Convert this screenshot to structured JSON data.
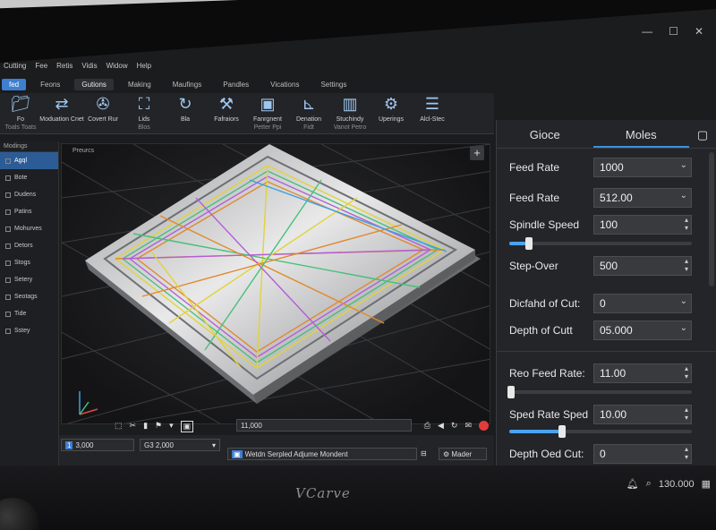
{
  "menu": [
    "Cutting",
    "Fee",
    "Retis",
    "Vidis",
    "Widow",
    "Help"
  ],
  "tabs": [
    {
      "label": "fed",
      "state": "active"
    },
    {
      "label": "Feons",
      "state": ""
    },
    {
      "label": "Gutions",
      "state": "sel"
    },
    {
      "label": "Making",
      "state": ""
    },
    {
      "label": "Maufings",
      "state": ""
    },
    {
      "label": "Pandles",
      "state": ""
    },
    {
      "label": "Vications",
      "state": ""
    },
    {
      "label": "Settings",
      "state": ""
    }
  ],
  "ribbon": [
    {
      "label": "Fo",
      "sub": "Toals Toats",
      "icon": "folder-icon"
    },
    {
      "label": "Moduation Cnet",
      "sub": "",
      "icon": "arrows-icon"
    },
    {
      "label": "Covert Rur",
      "sub": "",
      "icon": "fan-icon"
    },
    {
      "label": "Lids",
      "sub": "Blos",
      "icon": "frame-icon"
    },
    {
      "label": "Bla",
      "sub": "",
      "icon": "rotate-icon"
    },
    {
      "label": "Fafraiors",
      "sub": "",
      "icon": "tools-icon"
    },
    {
      "label": "Fanrgnent",
      "sub": "Petter Ppi",
      "icon": "box-icon"
    },
    {
      "label": "Denation",
      "sub": "Fidt",
      "icon": "axis-icon"
    },
    {
      "label": "Stuchindy",
      "sub": "Vanot Petro",
      "icon": "cylinder-icon"
    },
    {
      "label": "Uperings",
      "sub": "",
      "icon": "gears-icon"
    },
    {
      "label": "Alcl-Stec",
      "sub": "",
      "icon": "layers-icon"
    }
  ],
  "tree": {
    "header": "Modings",
    "items": [
      {
        "label": "Agql",
        "selected": true
      },
      {
        "label": "Bote",
        "selected": false
      },
      {
        "label": "Dudens",
        "selected": false
      },
      {
        "label": "Patins",
        "selected": false
      },
      {
        "label": "Mohurves",
        "selected": false
      },
      {
        "label": "Detors",
        "selected": false
      },
      {
        "label": "Stogs",
        "selected": false
      },
      {
        "label": "Setery",
        "selected": false
      },
      {
        "label": "Seotags",
        "selected": false
      },
      {
        "label": "Tide",
        "selected": false
      },
      {
        "label": "Sstey",
        "selected": false
      }
    ]
  },
  "viewport": {
    "label": "Preurcs",
    "value": "11,000",
    "toolbar_icons": [
      "select-icon",
      "cut-icon",
      "fill-icon",
      "flag-icon",
      "pin-icon",
      "save-icon"
    ]
  },
  "status": {
    "field1": "3,000",
    "field2": "G3 2,000",
    "message": "Wetdn Serpled Adjume Mondent",
    "button": "Mader"
  },
  "panel": {
    "tab1": "Gioce",
    "tab2": "Moles",
    "params": [
      {
        "label": "Feed Rate",
        "value": "1000",
        "control": "dropdown"
      },
      {
        "label": "Feed Rate",
        "value": "512.00",
        "control": "dropdown"
      },
      {
        "label": "Spindle Speed",
        "value": "100",
        "control": "spinner"
      },
      {
        "label": "Step-Over",
        "value": "500",
        "control": "spinner"
      },
      {
        "label": "Dicfahd of Cut:",
        "value": "0",
        "control": "dropdown"
      },
      {
        "label": "Depth of Cutt",
        "value": "05.000",
        "control": "dropdown"
      },
      {
        "label": "Reo Feed Rate:",
        "value": "11.00",
        "control": "spinner"
      },
      {
        "label": "Sped Rate Sped",
        "value": "10.00",
        "control": "spinner"
      },
      {
        "label": "Depth Oed Cut:",
        "value": "0",
        "control": "spinner"
      }
    ],
    "sliders": [
      0.1,
      0.0,
      0.28
    ]
  },
  "taskbar": {
    "time": "130.000",
    "brand": "VCarve"
  },
  "colors": {
    "accent": "#3d8fe0",
    "active_tab": "#3d7fd1"
  }
}
